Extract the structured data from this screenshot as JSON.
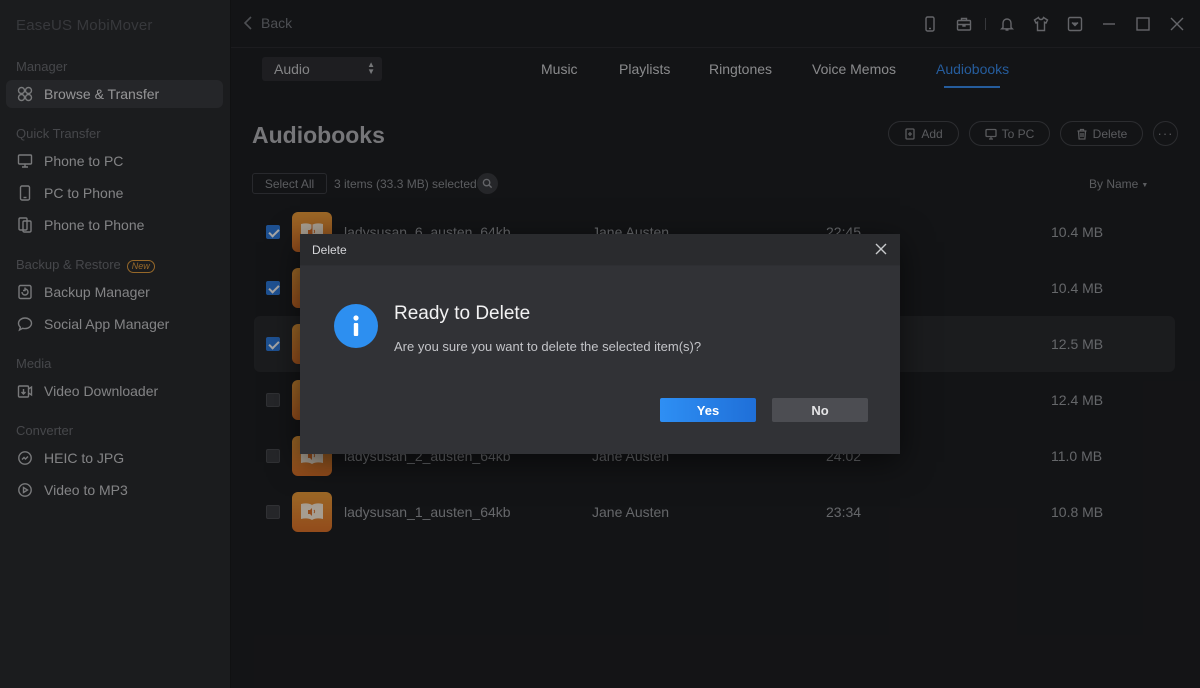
{
  "app": {
    "title": "EaseUS MobiMover"
  },
  "sidebar": {
    "sections": [
      {
        "label": "Manager",
        "items": [
          {
            "label": "Browse & Transfer",
            "icon": "browse-icon",
            "active": true
          }
        ]
      },
      {
        "label": "Quick Transfer",
        "items": [
          {
            "label": "Phone to PC",
            "icon": "phone-to-pc-icon"
          },
          {
            "label": "PC to Phone",
            "icon": "pc-to-phone-icon"
          },
          {
            "label": "Phone to Phone",
            "icon": "phone-to-phone-icon"
          }
        ]
      },
      {
        "label": "Backup & Restore",
        "badge": "New",
        "items": [
          {
            "label": "Backup Manager",
            "icon": "backup-icon"
          },
          {
            "label": "Social App Manager",
            "icon": "chat-icon"
          }
        ]
      },
      {
        "label": "Media",
        "items": [
          {
            "label": "Video Downloader",
            "icon": "download-icon"
          }
        ]
      },
      {
        "label": "Converter",
        "items": [
          {
            "label": "HEIC to JPG",
            "icon": "image-convert-icon"
          },
          {
            "label": "Video to MP3",
            "icon": "video-convert-icon"
          }
        ]
      }
    ]
  },
  "topbar": {
    "back_label": "Back"
  },
  "category": {
    "selected": "Audio"
  },
  "tabs": [
    "Music",
    "Playlists",
    "Ringtones",
    "Voice Memos",
    "Audiobooks"
  ],
  "active_tab": "Audiobooks",
  "page": {
    "title": "Audiobooks",
    "add_label": "Add",
    "topc_label": "To PC",
    "delete_label": "Delete",
    "more_label": "···",
    "select_all_label": "Select All",
    "selection_info": "3 items (33.3 MB) selected",
    "sort_label": "By Name"
  },
  "rows": [
    {
      "name": "ladysusan_6_austen_64kb",
      "author": "Jane Austen",
      "duration": "22:45",
      "size": "10.4 MB",
      "checked": true
    },
    {
      "name": "",
      "author": "",
      "duration": "",
      "size": "10.4 MB",
      "checked": true
    },
    {
      "name": "",
      "author": "",
      "duration": "",
      "size": "12.5 MB",
      "checked": true
    },
    {
      "name": "",
      "author": "",
      "duration": "",
      "size": "12.4 MB",
      "checked": false
    },
    {
      "name": "ladysusan_2_austen_64kb",
      "author": "Jane Austen",
      "duration": "24:02",
      "size": "11.0 MB",
      "checked": false
    },
    {
      "name": "ladysusan_1_austen_64kb",
      "author": "Jane Austen",
      "duration": "23:34",
      "size": "10.8 MB",
      "checked": false
    }
  ],
  "dialog": {
    "title": "Delete",
    "heading": "Ready to Delete",
    "message": "Are you sure you want to delete the selected item(s)?",
    "yes_label": "Yes",
    "no_label": "No"
  },
  "colors": {
    "accent": "#3a8ef0",
    "primary_button": "#2e8ff4",
    "thumb": "#e8882f"
  }
}
